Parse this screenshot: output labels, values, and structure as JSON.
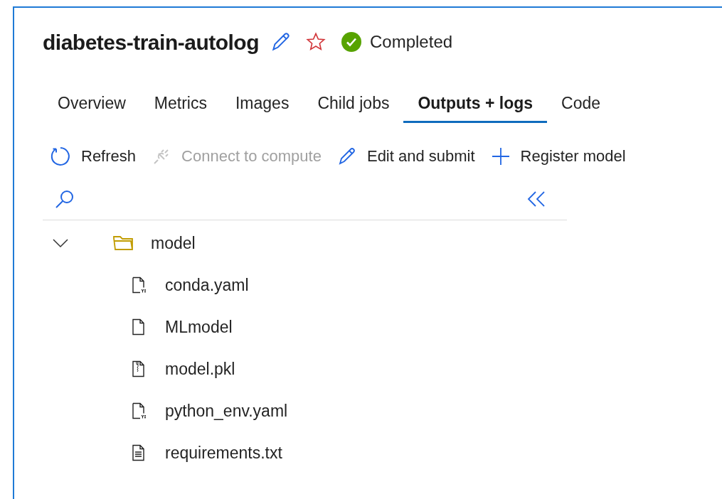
{
  "header": {
    "title": "diabetes-train-autolog",
    "favorite": false,
    "status": {
      "label": "Completed",
      "kind": "success"
    }
  },
  "tabs": [
    {
      "label": "Overview",
      "selected": false
    },
    {
      "label": "Metrics",
      "selected": false
    },
    {
      "label": "Images",
      "selected": false
    },
    {
      "label": "Child jobs",
      "selected": false
    },
    {
      "label": "Outputs + logs",
      "selected": true
    },
    {
      "label": "Code",
      "selected": false
    }
  ],
  "toolbar": [
    {
      "label": "Refresh",
      "kind": "refresh",
      "disabled": false
    },
    {
      "label": "Connect to compute",
      "kind": "connect",
      "disabled": true
    },
    {
      "label": "Edit and submit",
      "kind": "edit",
      "disabled": false
    },
    {
      "label": "Register model",
      "kind": "add",
      "disabled": false
    }
  ],
  "file_tree": [
    {
      "name": "model",
      "kind": "folder",
      "expanded": true,
      "children": [
        {
          "name": "conda.yaml",
          "kind": "yaml"
        },
        {
          "name": "MLmodel",
          "kind": "file"
        },
        {
          "name": "model.pkl",
          "kind": "zip"
        },
        {
          "name": "python_env.yaml",
          "kind": "yaml"
        },
        {
          "name": "requirements.txt",
          "kind": "text"
        }
      ]
    }
  ]
}
